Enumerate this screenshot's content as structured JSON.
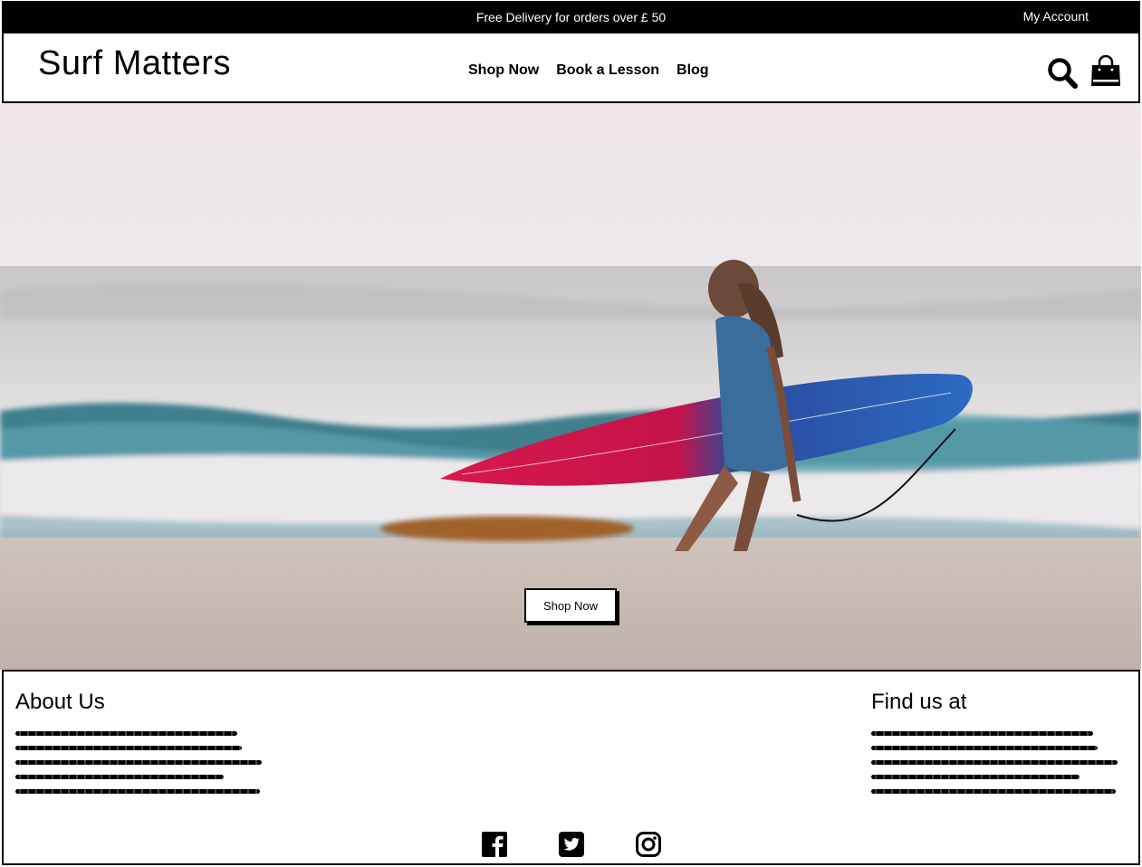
{
  "promo": {
    "text": "Free Delivery for orders over £ 50",
    "account_label": "My Account"
  },
  "header": {
    "logo": "Surf Matters",
    "nav": [
      "Shop Now",
      "Book a Lesson",
      "Blog"
    ],
    "icons": [
      "search-icon",
      "shopping-bag-icon"
    ]
  },
  "hero": {
    "cta_label": "Shop Now"
  },
  "footer": {
    "about_title": "About Us",
    "find_title": "Find us at",
    "social_icons": [
      "facebook-icon",
      "twitter-icon",
      "instagram-icon"
    ]
  },
  "colors": {
    "bar": "#000000",
    "background": "#ffffff"
  }
}
